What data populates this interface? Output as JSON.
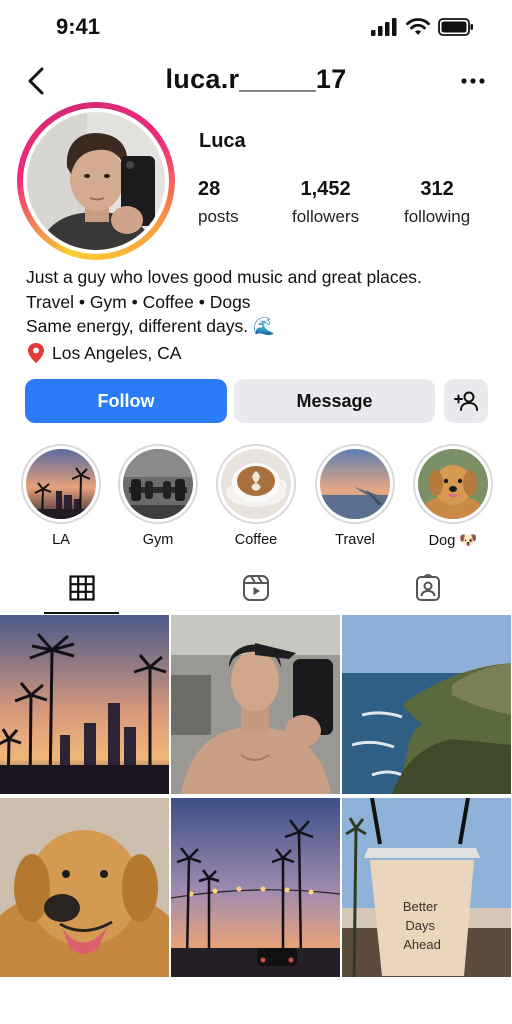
{
  "status_bar": {
    "time": "9:41"
  },
  "header": {
    "username": "luca.r_____17"
  },
  "profile": {
    "display_name": "Luca",
    "stats": [
      {
        "value": "28",
        "label": "posts"
      },
      {
        "value": "1,452",
        "label": "followers"
      },
      {
        "value": "312",
        "label": "following"
      }
    ],
    "bio": {
      "line1": "Just a guy who loves good music and great places.",
      "line2": "Travel • Gym • Coffee • Dogs",
      "line3": "Same energy, different days. 🌊",
      "location": "Los Angeles, CA"
    }
  },
  "actions": {
    "follow_label": "Follow",
    "message_label": "Message"
  },
  "highlights": [
    {
      "label": "LA"
    },
    {
      "label": "Gym"
    },
    {
      "label": "Coffee"
    },
    {
      "label": "Travel"
    },
    {
      "label": "Dog 🐶"
    }
  ],
  "tabs": [
    "grid-icon",
    "reels-icon",
    "tagged-icon"
  ],
  "grid": {
    "cup_text": "Better Days Ahead"
  },
  "colors": {
    "follow": "#2a7cf6",
    "message": "#e9eaed",
    "ring_gradient": [
      "#f9ce34",
      "#ee2a7b",
      "#d62976"
    ]
  }
}
